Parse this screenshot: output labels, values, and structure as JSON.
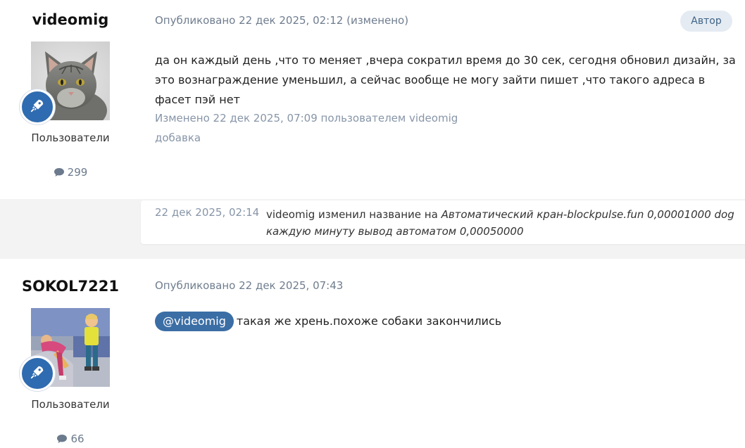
{
  "posts": [
    {
      "author": "videomig",
      "group": "Пользователи",
      "post_count": "299",
      "meta": "Опубликовано 22 дек 2025, 02:12 (изменено)",
      "badge": "Автор",
      "content": "да он каждый день ,что то меняет ,вчера сократил время до 30 сек, сегодня обновил дизайн, за это вознаграждение уменьшил, а сейчас вообще не могу зайти пишет ,что такого адреса в фасет пэй нет",
      "edited": "Изменено 22 дек 2025, 07:09 пользователем videomig",
      "edit_reason": "добавка",
      "avatar_icon": "cat-photo",
      "rank_icon": "rocket-icon"
    },
    {
      "author": "SOKOL7221",
      "group": "Пользователи",
      "post_count": "66",
      "meta": "Опубликовано 22 дек 2025, 07:43",
      "mention": "@videomig",
      "content": "такая же хрень.похоже собаки закончились",
      "avatar_icon": "kids-photo",
      "rank_icon": "rocket-icon"
    }
  ],
  "event": {
    "time": "22 дек 2025, 02:14",
    "text": "videomig изменил название на",
    "title": "Автоматический кран-blockpulse.fun 0,00001000 dog каждую минуту вывод автоматом 0,00050000"
  },
  "colors": {
    "accent": "#2f6bb0",
    "mention_bg": "#3b6ea5",
    "meta_text": "#6f7d8f",
    "separator_bg": "#f3f3f3"
  }
}
